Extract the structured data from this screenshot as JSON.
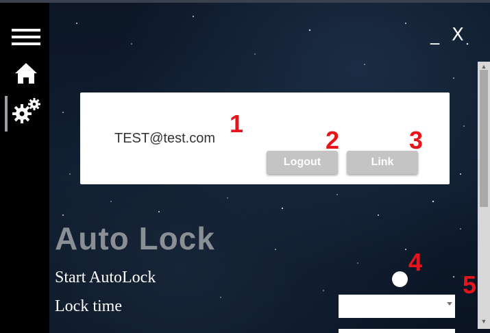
{
  "window": {
    "minimize_label": "_",
    "close_label": "X"
  },
  "sidebar": {
    "items": [
      {
        "name": "menu",
        "icon": "hamburger-menu-icon"
      },
      {
        "name": "home",
        "icon": "home-icon"
      },
      {
        "name": "settings",
        "icon": "gears-icon",
        "active": true
      }
    ]
  },
  "account": {
    "email": "TEST@test.com",
    "logout_label": "Logout",
    "link_label": "Link"
  },
  "annotations": [
    "1",
    "2",
    "3",
    "4",
    "5"
  ],
  "autolock": {
    "title": "Auto Lock",
    "start_label": "Start AutoLock",
    "lock_time_label": "Lock time",
    "lock_time_value": ""
  },
  "colors": {
    "card_bg": "#ffffff",
    "button_bg": "#c4c4c4",
    "annotation": "#e8141c",
    "title": "#8a8f96",
    "sidebar_bg": "#000000"
  }
}
